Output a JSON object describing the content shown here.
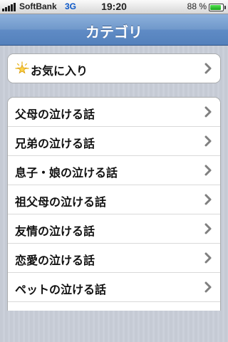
{
  "status_bar": {
    "carrier": "SoftBank",
    "network": "3G",
    "time": "19:20",
    "battery_text": "88 %",
    "battery_level": 0.88
  },
  "nav": {
    "title": "カテゴリ"
  },
  "favorites": {
    "label": "お気に入り",
    "icon": "star-icon"
  },
  "categories": [
    {
      "label": "父母の泣ける話"
    },
    {
      "label": "兄弟の泣ける話"
    },
    {
      "label": "息子・娘の泣ける話"
    },
    {
      "label": "祖父母の泣ける話"
    },
    {
      "label": "友情の泣ける話"
    },
    {
      "label": "恋愛の泣ける話"
    },
    {
      "label": "ペットの泣ける話"
    }
  ],
  "colors": {
    "nav_bar": "#6f96c8",
    "background": "#c7ccd6",
    "chevron": "#7f7f7f"
  }
}
